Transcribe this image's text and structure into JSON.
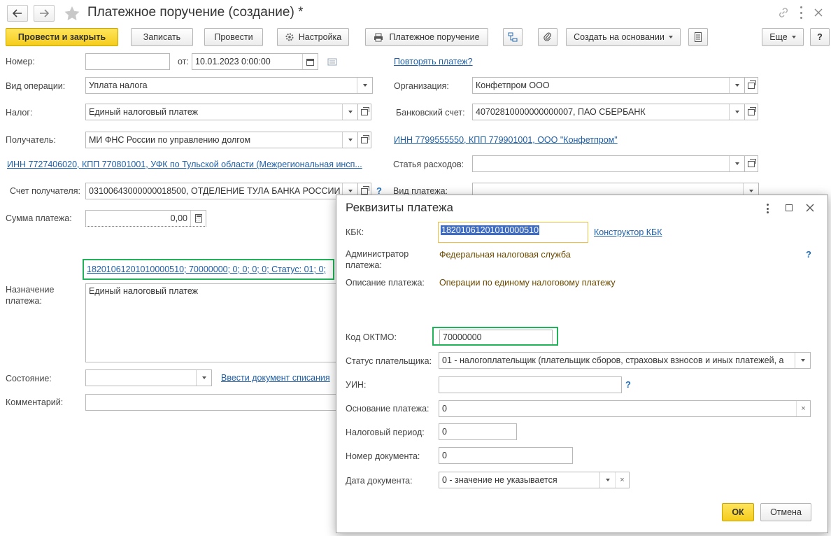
{
  "window": {
    "title": "Платежное поручение (создание) *"
  },
  "toolbar": {
    "post_close": "Провести и закрыть",
    "save": "Записать",
    "post": "Провести",
    "settings": "Настройка",
    "print": "Платежное поручение",
    "create_based": "Создать на основании",
    "more": "Еще",
    "help": "?"
  },
  "form": {
    "number_label": "Номер:",
    "number_value": "",
    "date_from_label": "от:",
    "date_value": "10.01.2023  0:00:00",
    "repeat_link": "Повторять платеж?",
    "operation_label": "Вид операции:",
    "operation_value": "Уплата налога",
    "org_label": "Организация:",
    "org_value": "Конфетпром ООО",
    "tax_label": "Налог:",
    "tax_value": "Единый налоговый платеж",
    "bank_account_label": "Банковский счет:",
    "bank_account_value": "40702810000000000007, ПАО СБЕРБАНК",
    "recipient_label": "Получатель:",
    "recipient_value": "МИ ФНС России по управлению долгом",
    "org_inn_link": "ИНН 7799555550, КПП 779901001, ООО \"Конфетпром\"",
    "recipient_inn_link": "ИНН 7727406020, КПП 770801001, УФК по Тульской области (Межрегиональная инсп...",
    "expense_label": "Статья расходов:",
    "expense_value": "",
    "recipient_account_label": "Счет получателя:",
    "recipient_account_value": "03100643000000018500, ОТДЕЛЕНИЕ ТУЛА БАНКА РОССИИ",
    "payment_type_label": "Вид платежа:",
    "sum_label": "Сумма платежа:",
    "sum_value": "0,00",
    "requisites_link": "18201061201010000510; 70000000; 0; 0; 0; 0; Статус: 01; 0;",
    "purpose_label": "Назначение платежа:",
    "purpose_value": "Единый налоговый платеж",
    "status_label": "Состояние:",
    "status_value": "",
    "write_off_link": "Ввести документ списания",
    "comment_label": "Комментарий:",
    "comment_value": ""
  },
  "dialog": {
    "title": "Реквизиты платежа",
    "kbk_label": "КБК:",
    "kbk_value": "18201061201010000510",
    "kbk_constructor_link": "Конструктор КБК",
    "admin_label": "Администратор платежа:",
    "admin_value": "Федеральная налоговая служба",
    "desc_label": "Описание платежа:",
    "desc_value": "Операции по единому налоговому платежу",
    "oktmo_label": "Код ОКТМО:",
    "oktmo_value": "70000000",
    "payer_status_label": "Статус плательщика:",
    "payer_status_value": "01 - налогоплательщик (плательщик сборов, страховых взносов и иных платежей, а",
    "uin_label": "УИН:",
    "uin_value": "",
    "basis_label": "Основание платежа:",
    "basis_value": "0",
    "tax_period_label": "Налоговый период:",
    "tax_period_value": "0",
    "doc_number_label": "Номер документа:",
    "doc_number_value": "0",
    "doc_date_label": "Дата документа:",
    "doc_date_value": "0 - значение не указывается",
    "ok": "ОК",
    "cancel": "Отмена"
  },
  "colors": {
    "accent_yellow": "#f5cd1b",
    "link_blue": "#1f5fa8",
    "highlight_green": "#22b35a",
    "focus_orange": "#f0c040"
  }
}
